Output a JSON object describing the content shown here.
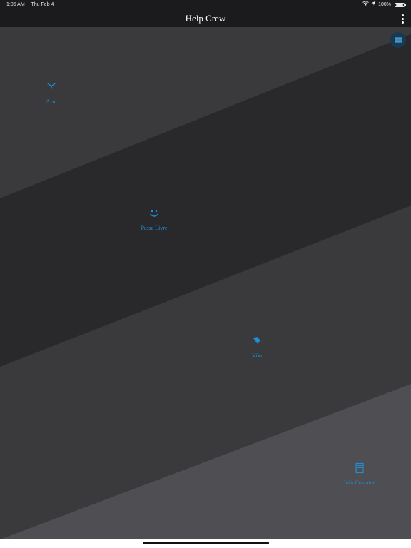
{
  "status": {
    "time": "1:05 AM",
    "date": "Thu Feb 4",
    "battery": "100%"
  },
  "nav": {
    "title": "Help Crew"
  },
  "tiles": [
    {
      "label": "Azul",
      "icon": "bird-icon"
    },
    {
      "label": "Passe Livre",
      "icon": "smile-icon"
    },
    {
      "label": "Vôo",
      "icon": "diamond-icon"
    },
    {
      "label": "Info Contatos",
      "icon": "document-icon"
    }
  ],
  "colors": {
    "accent": "#1e8fd6",
    "bar": "#1b1b1d"
  }
}
